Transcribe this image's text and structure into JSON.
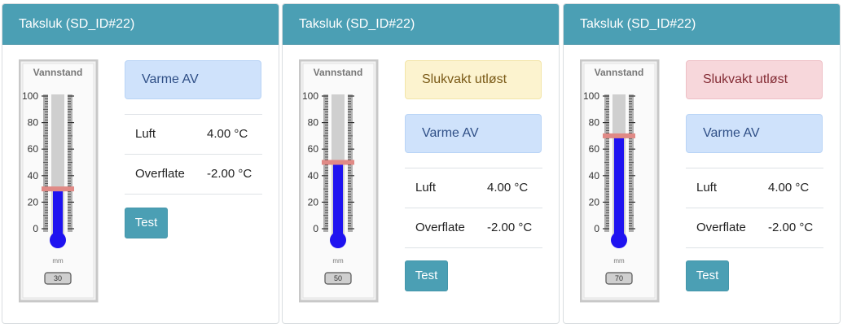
{
  "colors": {
    "header": "#4b9fb4",
    "mercury": "#1f13f0",
    "marker": "#e08a86",
    "info": "#cfe2fb",
    "warning": "#fcf3cf",
    "danger": "#f7d7db"
  },
  "cards": [
    {
      "title": "Taksluk (SD_ID#22)",
      "gauge": {
        "label": "Vannstand",
        "unit": "mm",
        "value": 30,
        "min": 0,
        "max": 100,
        "ticks": [
          "100",
          "80",
          "60",
          "40",
          "20",
          "0"
        ],
        "value_text": "30"
      },
      "alerts": [
        {
          "text": "Varme AV",
          "level": "info"
        }
      ],
      "readings": [
        {
          "label": "Luft",
          "value": "4.00 °C"
        },
        {
          "label": "Overflate",
          "value": "-2.00 °C"
        }
      ],
      "test_button": "Test"
    },
    {
      "title": "Taksluk (SD_ID#22)",
      "gauge": {
        "label": "Vannstand",
        "unit": "mm",
        "value": 50,
        "min": 0,
        "max": 100,
        "ticks": [
          "100",
          "80",
          "60",
          "40",
          "20",
          "0"
        ],
        "value_text": "50"
      },
      "alerts": [
        {
          "text": "Slukvakt utløst",
          "level": "warning"
        },
        {
          "text": "Varme AV",
          "level": "info"
        }
      ],
      "readings": [
        {
          "label": "Luft",
          "value": "4.00 °C"
        },
        {
          "label": "Overflate",
          "value": "-2.00 °C"
        }
      ],
      "test_button": "Test"
    },
    {
      "title": "Taksluk (SD_ID#22)",
      "gauge": {
        "label": "Vannstand",
        "unit": "mm",
        "value": 70,
        "min": 0,
        "max": 100,
        "ticks": [
          "100",
          "80",
          "60",
          "40",
          "20",
          "0"
        ],
        "value_text": "70"
      },
      "alerts": [
        {
          "text": "Slukvakt utløst",
          "level": "danger"
        },
        {
          "text": "Varme AV",
          "level": "info"
        }
      ],
      "readings": [
        {
          "label": "Luft",
          "value": "4.00 °C"
        },
        {
          "label": "Overflate",
          "value": "-2.00 °C"
        }
      ],
      "test_button": "Test"
    }
  ]
}
